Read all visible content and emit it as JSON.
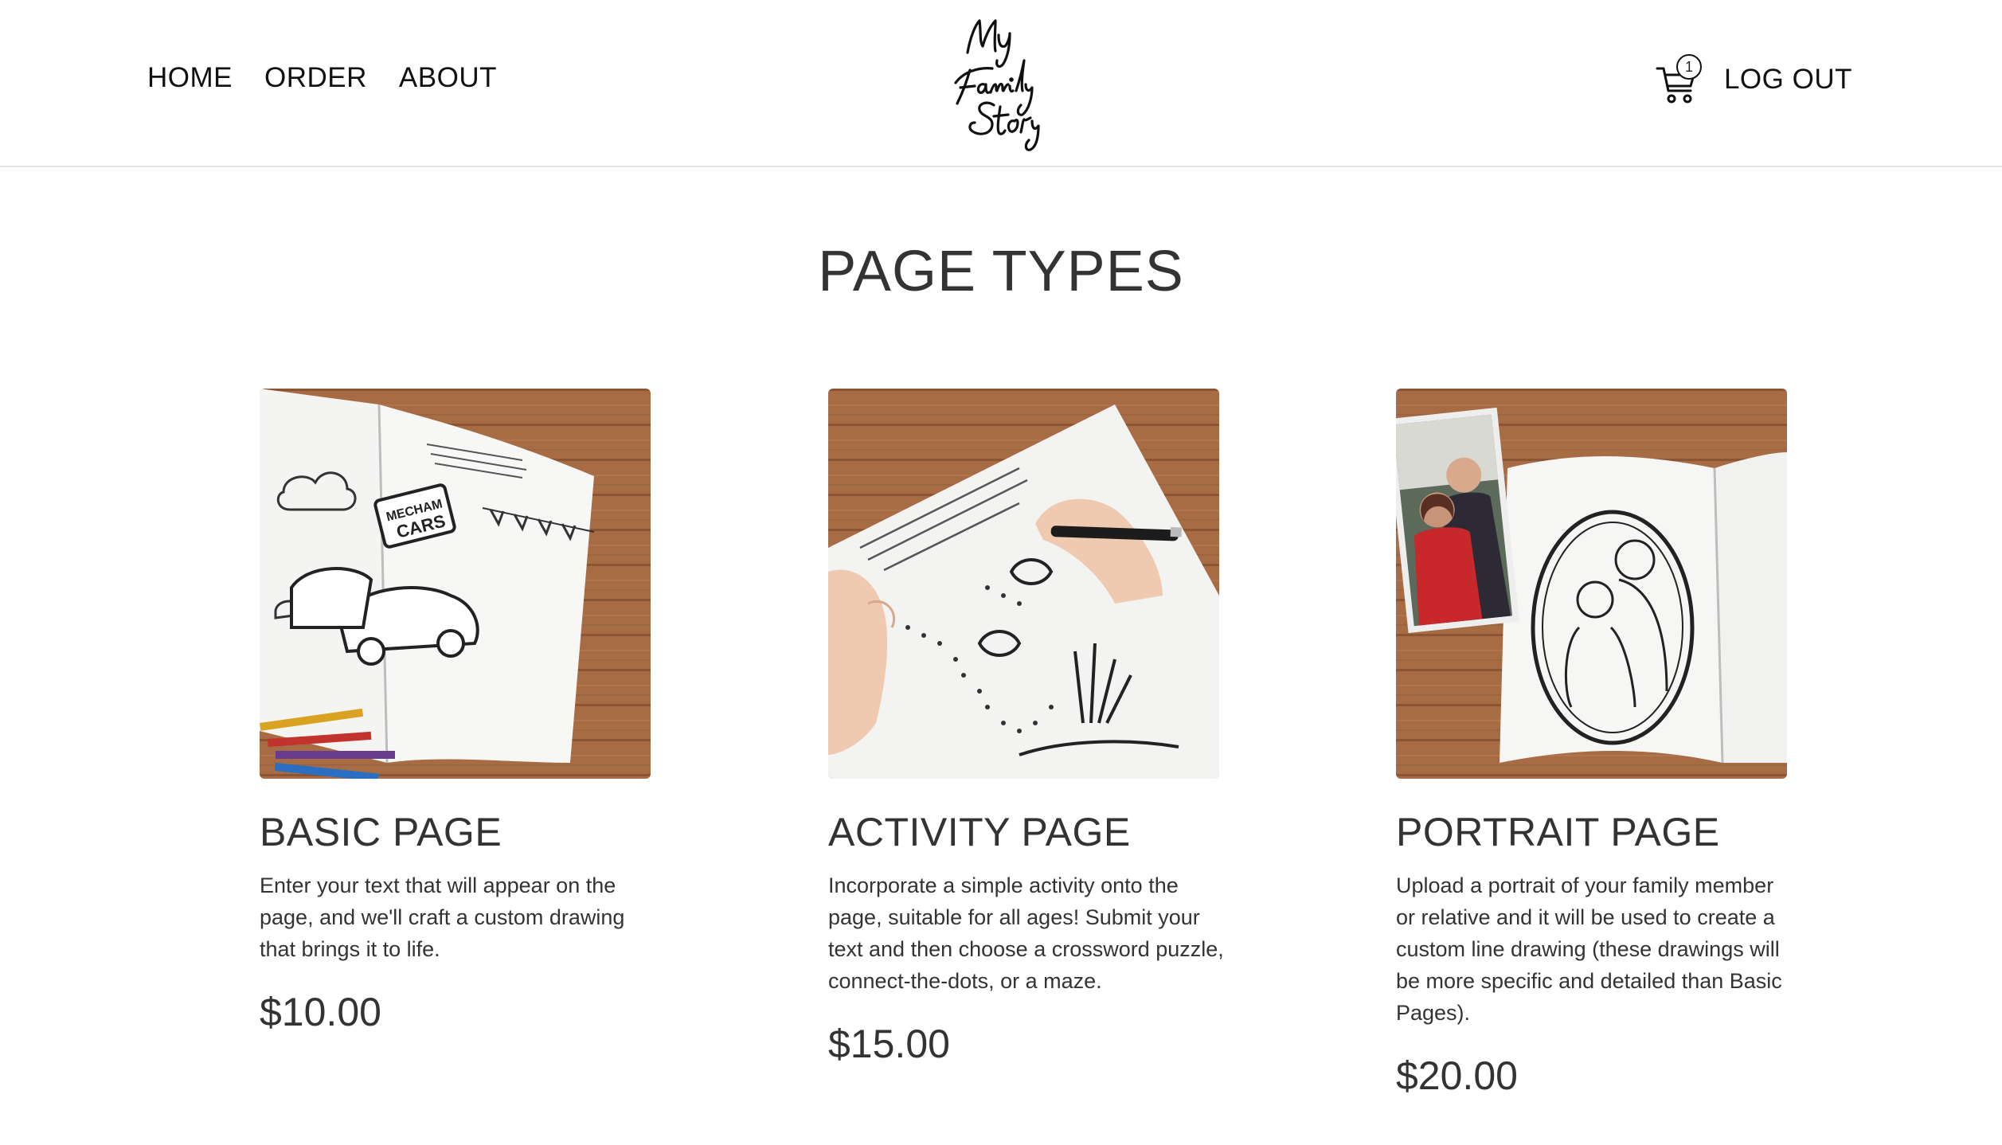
{
  "nav": {
    "links": [
      "HOME",
      "ORDER",
      "ABOUT"
    ],
    "logo_text": "My Family Story",
    "cart_count": "1",
    "logout_label": "LOG OUT"
  },
  "page_title": "PAGE TYPES",
  "cards": [
    {
      "title": "BASIC PAGE",
      "description": "Enter your text that will appear on the page, and we'll craft a custom drawing that brings it to life.",
      "price": "$10.00",
      "image": "coloring book on wooden table with crayons"
    },
    {
      "title": "ACTIVITY PAGE",
      "description": "Incorporate a simple activity onto the page, suitable for all ages! Submit your text and then choose a crossword puzzle, connect-the-dots, or a maze.",
      "price": "$15.00",
      "image": "child hands drawing connect-the-dots page"
    },
    {
      "title": "PORTRAIT PAGE",
      "description": "Upload a portrait of your family member or relative and it will be used to create a custom line drawing (these drawings will be more specific and detailed than Basic Pages).",
      "price": "$20.00",
      "image": "family photo beside portrait line drawing"
    }
  ],
  "colors": {
    "wood": "#a8704a",
    "wood_dark": "#8a5636",
    "text": "#333333",
    "divider": "#e4e4e4"
  }
}
